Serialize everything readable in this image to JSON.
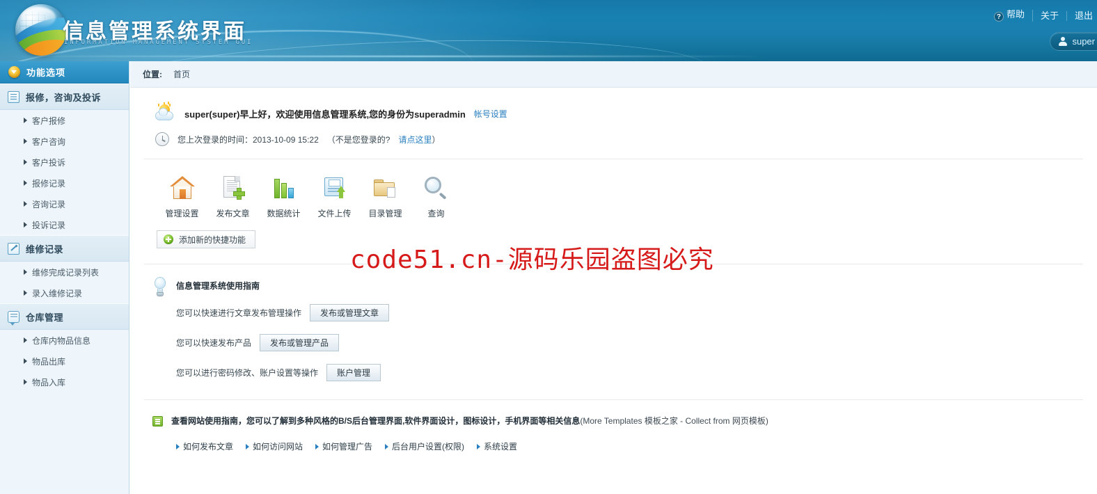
{
  "header": {
    "brand_cn": "信息管理系统界面",
    "brand_en": "INFORMATION MANAGEMENT SYSTEM GUI",
    "top_links": [
      {
        "label": "帮助",
        "icon": "help-icon",
        "badge": "?"
      },
      {
        "label": "关于",
        "icon": ""
      },
      {
        "label": "退出",
        "icon": ""
      }
    ],
    "user": {
      "name": "super",
      "icon": "user-icon"
    }
  },
  "sidebar": {
    "panel_title": "功能选项",
    "panel_icon": "chevron-down-orb-icon",
    "groups": [
      {
        "label": "报修，咨询及投诉",
        "icon": "list-icon",
        "items": [
          {
            "label": "客户报修"
          },
          {
            "label": "客户咨询"
          },
          {
            "label": "客户投诉"
          },
          {
            "label": "报修记录"
          },
          {
            "label": "咨询记录"
          },
          {
            "label": "投诉记录"
          }
        ]
      },
      {
        "label": "维修记录",
        "icon": "pencil-icon",
        "items": [
          {
            "label": "维修完成记录列表"
          },
          {
            "label": "录入维修记录"
          }
        ]
      },
      {
        "label": "仓库管理",
        "icon": "chat-icon",
        "items": [
          {
            "label": "仓库内物品信息"
          },
          {
            "label": "物品出库"
          },
          {
            "label": "物品入库"
          }
        ]
      }
    ]
  },
  "breadcrumb": {
    "label": "位置:",
    "current": "首页"
  },
  "welcome": {
    "icon": "sun-cloud-icon",
    "text": "super(super)早上好，欢迎使用信息管理系统,您的身份为superadmin",
    "account_link": "帐号设置"
  },
  "last_login": {
    "icon": "clock-icon",
    "prefix": "您上次登录的时间：2013-10-09 15:22",
    "question": "（不是您登录的?",
    "link": "请点这里",
    "suffix": "）"
  },
  "shortcuts": {
    "items": [
      {
        "label": "管理设置",
        "icon": "home-icon"
      },
      {
        "label": "发布文章",
        "icon": "document-add-icon"
      },
      {
        "label": "数据统计",
        "icon": "bar-chart-icon"
      },
      {
        "label": "文件上传",
        "icon": "file-upload-icon"
      },
      {
        "label": "目录管理",
        "icon": "folder-icon"
      },
      {
        "label": "查询",
        "icon": "magnifier-icon"
      }
    ],
    "add_button": "添加新的快捷功能",
    "add_button_icon": "plus-circle-icon"
  },
  "watermark": "code51.cn-源码乐园盗图必究",
  "guide": {
    "icon": "lightbulb-icon",
    "title": "信息管理系统使用指南",
    "rows": [
      {
        "text": "您可以快速进行文章发布管理操作",
        "button": "发布或管理文章"
      },
      {
        "text": "您可以快速发布产品",
        "button": "发布或管理产品"
      },
      {
        "text": "您可以进行密码修改、账户设置等操作",
        "button": "账户管理"
      }
    ]
  },
  "bottom": {
    "icon": "green-note-icon",
    "notice_bold": "查看网站使用指南，您可以了解到多种风格的B/S后台管理界面,软件界面设计，图标设计，手机界面等相关信息",
    "notice_paren": "(More Templates 模板之家 - Collect from 网页模板)",
    "links": [
      {
        "label": "如何发布文章"
      },
      {
        "label": "如何访问网站"
      },
      {
        "label": "如何管理广告"
      },
      {
        "label": "后台用户设置(权限)"
      },
      {
        "label": "系统设置"
      }
    ]
  },
  "colors": {
    "header_blue": "#1881b2",
    "sidebar_bg": "#eef6fc",
    "panel_header": "#2f93c7",
    "group_header": "#dce9f2",
    "link_blue": "#2a7fbf",
    "watermark_red": "#d61a1a",
    "accent_green": "#8cc63f",
    "accent_orange": "#f6c437"
  }
}
